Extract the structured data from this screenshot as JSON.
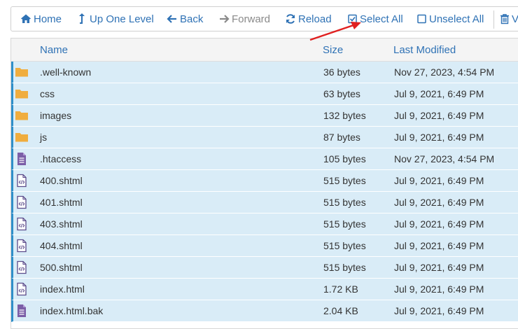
{
  "toolbar": {
    "home": "Home",
    "up_one_level": "Up One Level",
    "back": "Back",
    "forward": "Forward",
    "reload": "Reload",
    "select_all": "Select All",
    "unselect_all": "Unselect All",
    "view_trash_partial": "V"
  },
  "columns": {
    "name": "Name",
    "size": "Size",
    "last_modified": "Last Modified"
  },
  "files": [
    {
      "icon": "folder-icon",
      "name": ".well-known",
      "size": "36 bytes",
      "modified": "Nov 27, 2023, 4:54 PM"
    },
    {
      "icon": "folder-icon",
      "name": "css",
      "size": "63 bytes",
      "modified": "Jul 9, 2021, 6:49 PM"
    },
    {
      "icon": "folder-icon",
      "name": "images",
      "size": "132 bytes",
      "modified": "Jul 9, 2021, 6:49 PM"
    },
    {
      "icon": "folder-icon",
      "name": "js",
      "size": "87 bytes",
      "modified": "Jul 9, 2021, 6:49 PM"
    },
    {
      "icon": "text-file-icon",
      "name": ".htaccess",
      "size": "105 bytes",
      "modified": "Nov 27, 2023, 4:54 PM"
    },
    {
      "icon": "code-file-icon",
      "name": "400.shtml",
      "size": "515 bytes",
      "modified": "Jul 9, 2021, 6:49 PM"
    },
    {
      "icon": "code-file-icon",
      "name": "401.shtml",
      "size": "515 bytes",
      "modified": "Jul 9, 2021, 6:49 PM"
    },
    {
      "icon": "code-file-icon",
      "name": "403.shtml",
      "size": "515 bytes",
      "modified": "Jul 9, 2021, 6:49 PM"
    },
    {
      "icon": "code-file-icon",
      "name": "404.shtml",
      "size": "515 bytes",
      "modified": "Jul 9, 2021, 6:49 PM"
    },
    {
      "icon": "code-file-icon",
      "name": "500.shtml",
      "size": "515 bytes",
      "modified": "Jul 9, 2021, 6:49 PM"
    },
    {
      "icon": "code-file-icon",
      "name": "index.html",
      "size": "1.72 KB",
      "modified": "Jul 9, 2021, 6:49 PM"
    },
    {
      "icon": "text-file-icon",
      "name": "index.html.bak",
      "size": "2.04 KB",
      "modified": "Jul 9, 2021, 6:49 PM"
    }
  ],
  "colors": {
    "link": "#2f72b5",
    "selected_row": "#d9ecf7",
    "folder": "#f0ad3e",
    "file": "#7b5ea7",
    "annotation_arrow": "#e02020"
  }
}
